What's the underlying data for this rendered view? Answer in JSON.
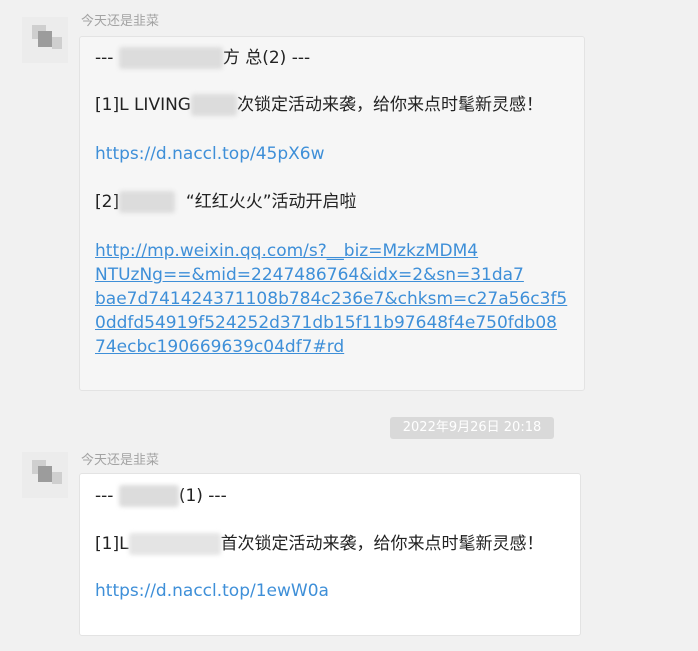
{
  "messages": [
    {
      "sender": "今天还是韭菜",
      "header": {
        "prefix": "---",
        "suffix": "方 总(2)  ---"
      },
      "item1": {
        "prefix": "[1]L LIVING",
        "text": "次锁定活动来袭，给你来点时髦新灵感！"
      },
      "link1": "https://d.naccl.top/45pX6w",
      "item2": {
        "prefix": "[2]",
        "text": "“红红火火”活动开启啦"
      },
      "link2_lines": [
        "http://mp.weixin.qq.com/s?__biz=MzkzMDM4",
        "NTUzNg==&mid=2247486764&idx=2&sn=31da7",
        "bae7d741424371108b784c236e7&chksm=c27a56c3f5",
        "0ddfd54919f524252d371db15f11b97648f4e750fdb08",
        "74ecbc190669639c04df7#rd"
      ]
    },
    {
      "sender": "今天还是韭菜",
      "header": {
        "prefix": "---",
        "suffix": "(1)  ---"
      },
      "item1": {
        "prefix": "[1]L",
        "text": "首次锁定活动来袭，给你来点时髦新灵感！"
      },
      "link1": "https://d.naccl.top/1ewW0a"
    }
  ],
  "timestamp": "2022年9月26日 20:18"
}
